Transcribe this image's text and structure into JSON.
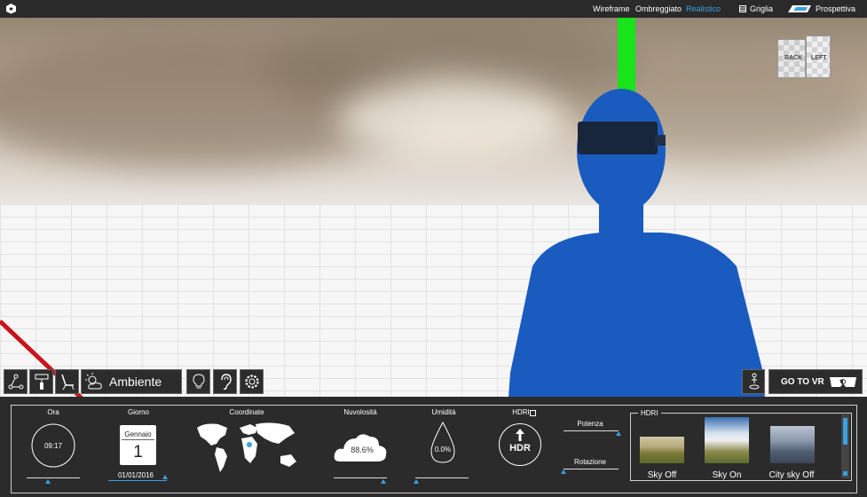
{
  "topbar": {
    "modes": [
      "Wireframe",
      "Ombreggiato",
      "Realistico"
    ],
    "active_mode": "Realistico",
    "grid_label": "Griglia",
    "perspective_label": "Prospettiva"
  },
  "viewcube": {
    "face_back": "BACK",
    "face_left": "LEFT"
  },
  "toolbar": {
    "ambient_label": "Ambiente",
    "go_vr_label": "GO TO VR"
  },
  "environment": {
    "time": {
      "label": "Ora",
      "value": "09:17"
    },
    "day": {
      "label": "Giorno",
      "month": "Gennaio",
      "day_number": "1",
      "date": "01/01/2016"
    },
    "coordinates": {
      "label": "Coordinate"
    },
    "cloudiness": {
      "label": "Nuvolosità",
      "value": "88.6%"
    },
    "humidity": {
      "label": "Umidità",
      "value": "0.0%"
    },
    "hdri": {
      "label": "HDRI",
      "icon_text": "HDR",
      "power_label": "Potenza",
      "rotation_label": "Rotazione"
    },
    "hdri_gallery": {
      "title": "HDRI",
      "items": [
        {
          "label": "Sky Off"
        },
        {
          "label": "Sky On"
        },
        {
          "label": "City sky Off"
        }
      ]
    }
  },
  "colors": {
    "accent": "#3aa0e0",
    "panel": "#2b2b2b",
    "figure": "#1a5bbf"
  }
}
